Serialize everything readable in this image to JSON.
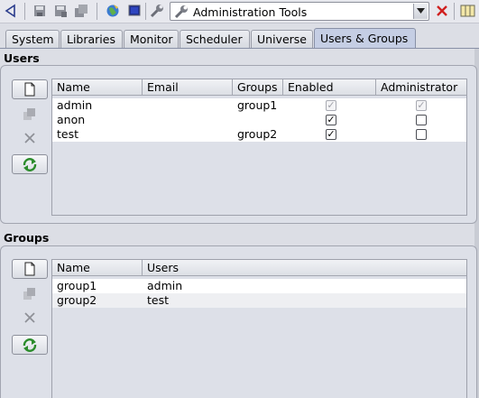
{
  "toolbar": {
    "combo_value": "Administration Tools",
    "icons": [
      "back-arrow-icon",
      "save-icon",
      "save-as-icon",
      "save-all-icon",
      "globe-icon",
      "monitor-icon",
      "wrench-icon",
      "close-icon",
      "panel-icon"
    ],
    "close_color": "#d02020"
  },
  "tabs": [
    {
      "label": "System"
    },
    {
      "label": "Libraries"
    },
    {
      "label": "Monitor"
    },
    {
      "label": "Scheduler"
    },
    {
      "label": "Universe"
    },
    {
      "label": "Users & Groups",
      "active": true
    }
  ],
  "users": {
    "title": "Users",
    "columns": [
      "Name",
      "Email",
      "Groups",
      "Enabled",
      "Administrator"
    ],
    "rows": [
      {
        "name": "admin",
        "email": "",
        "groups": "group1",
        "enabled": true,
        "enabled_disabled": true,
        "admin": true,
        "admin_disabled": true
      },
      {
        "name": "anon",
        "email": "",
        "groups": "",
        "enabled": true,
        "enabled_disabled": false,
        "admin": false,
        "admin_disabled": false
      },
      {
        "name": "test",
        "email": "",
        "groups": "group2",
        "enabled": true,
        "enabled_disabled": false,
        "admin": false,
        "admin_disabled": false
      }
    ]
  },
  "groups": {
    "title": "Groups",
    "columns": [
      "Name",
      "Users"
    ],
    "rows": [
      {
        "name": "group1",
        "users": "admin"
      },
      {
        "name": "group2",
        "users": "test"
      }
    ]
  },
  "check_glyph": "✓",
  "accent_tab": "#c5cee4"
}
